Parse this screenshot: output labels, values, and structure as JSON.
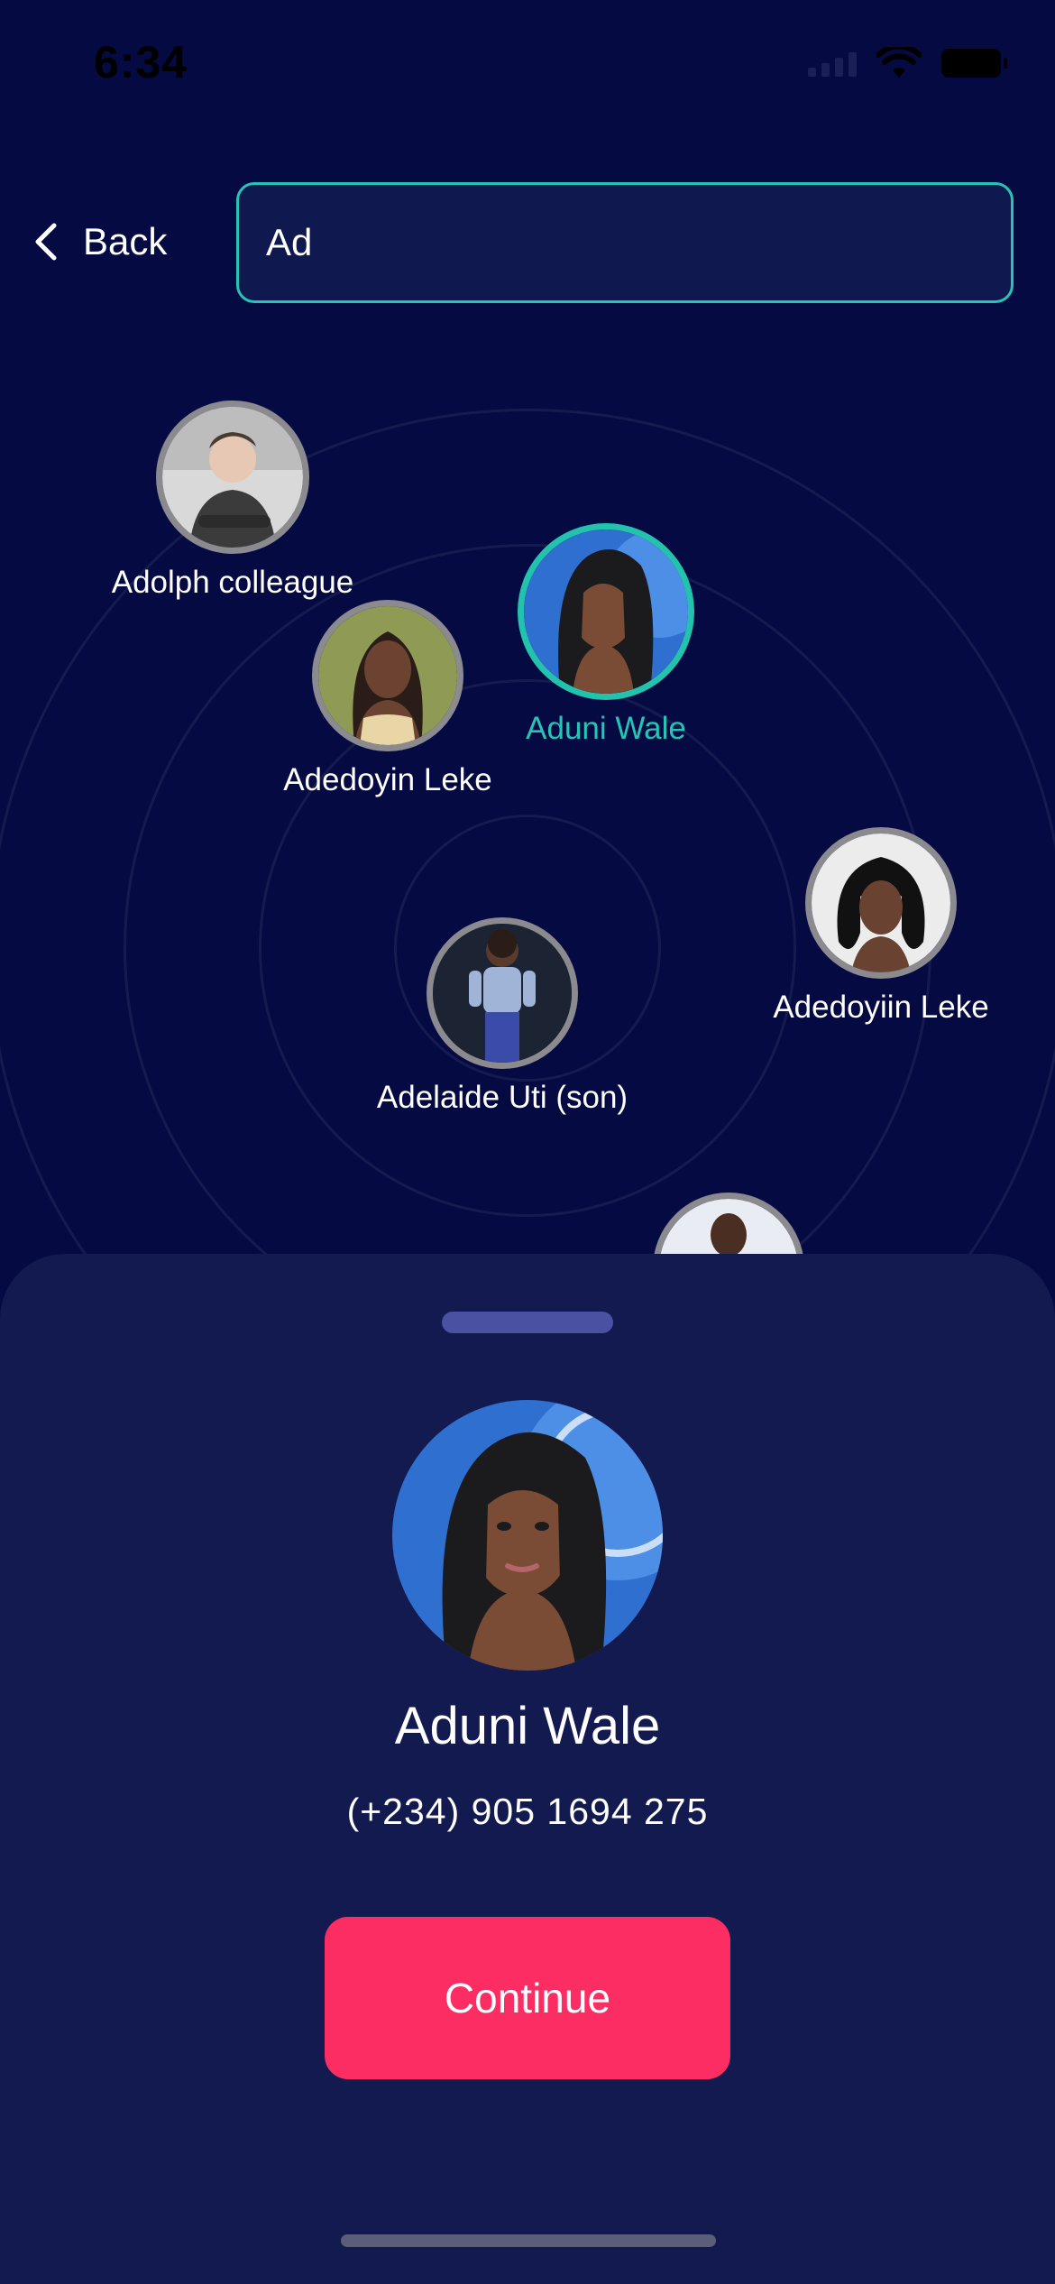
{
  "status_bar": {
    "time": "6:34"
  },
  "header": {
    "back_label": "Back",
    "search_value": "Ad",
    "search_placeholder": ""
  },
  "radar": {
    "contacts": [
      {
        "name": "Adolph colleague",
        "selected": false
      },
      {
        "name": "Aduni Wale",
        "selected": true
      },
      {
        "name": "Adedoyin Leke",
        "selected": false
      },
      {
        "name": "Adedoyiin Leke",
        "selected": false
      },
      {
        "name": "Adelaide Uti (son)",
        "selected": false
      }
    ]
  },
  "selected_contact": {
    "name": "Aduni Wale",
    "phone": "(+234) 905 1694 275"
  },
  "actions": {
    "continue_label": "Continue"
  },
  "colors": {
    "background": "#050a42",
    "sheet": "#121a4f",
    "accent_teal": "#27c4b5",
    "button_pink": "#fc2d63"
  }
}
